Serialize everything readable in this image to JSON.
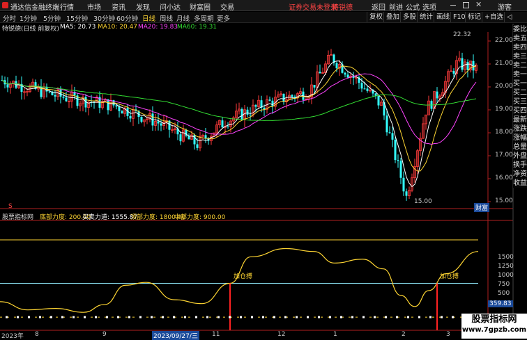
{
  "menubar": {
    "app_title": "通达信金融终端",
    "items": [
      "行情",
      "市场",
      "资讯",
      "发现",
      "问小达",
      "财富圈",
      "交易"
    ],
    "notice": "证券交易未登录",
    "stock": "特锐德",
    "window_buttons": [
      "返回",
      "前进",
      "公式",
      "选项"
    ],
    "guest": "游客"
  },
  "toolbar": {
    "periods": [
      "分时",
      "1分钟",
      "5分钟",
      "15分钟",
      "30分钟",
      "60分钟",
      "日线",
      "周线",
      "月线",
      "多周期",
      "更多"
    ],
    "active": "日线",
    "right_buttons": [
      "复权",
      "叠加",
      "多股",
      "统计",
      "画线",
      "F10",
      "标记",
      "+自选",
      "◁"
    ]
  },
  "main_chart": {
    "title": "特锐德(日线 前复权)",
    "ma": [
      {
        "label": "MA5: 20.73",
        "color": "#ffffff"
      },
      {
        "label": "MA10: 20.47",
        "color": "#ffd633"
      },
      {
        "label": "MA20: 19.83",
        "color": "#ff44ff"
      },
      {
        "label": "MA60: 19.31",
        "color": "#33dd33"
      }
    ],
    "y_ticks": [
      "22.00",
      "21.00",
      "20.00",
      "19.00",
      "18.00",
      "17.00",
      "16.00",
      "15.00"
    ],
    "high_label": "22.32",
    "low_label": "15.00",
    "corner_label": "S",
    "fund_label": "财富"
  },
  "indicator": {
    "name": "股票指标网",
    "params": [
      {
        "label": "底部力度: 200.00",
        "color": "#ffd633"
      },
      {
        "label": "买卖力道: 1555.87",
        "color": "#ffffff"
      },
      {
        "label": "顶部力度: 1800.00",
        "color": "#ffd633"
      },
      {
        "label": "中部力度: 900.00",
        "color": "#ffd633"
      }
    ],
    "y_ticks": [
      "1500",
      "1250",
      "1000",
      "750",
      "500"
    ],
    "value_box": "359.83",
    "signal_label": "加仓搏"
  },
  "x_axis": {
    "labels": [
      "2023年",
      "8",
      "9",
      "2023/09/27/三",
      "11",
      "12",
      "1",
      "2",
      "3"
    ]
  },
  "sidebar": {
    "items": [
      "委比",
      "卖五",
      "卖四",
      "卖三",
      "卖二",
      "卖一",
      "买一",
      "买二",
      "买三",
      "买四",
      "最新",
      "涨跌",
      "涨幅",
      "总量",
      "外盘",
      "换手",
      "净资",
      "收益"
    ]
  },
  "watermark": {
    "title": "股票指标网",
    "url": "www.7gpzb.com"
  },
  "colors": {
    "up": "#ff3b3b",
    "down": "#33ffff",
    "ma5": "#ffffff",
    "ma10": "#ffd633",
    "ma20": "#ff44ff",
    "ma60": "#33dd33",
    "indicator_line": "#ffd633",
    "signal": "#ff2222"
  }
}
